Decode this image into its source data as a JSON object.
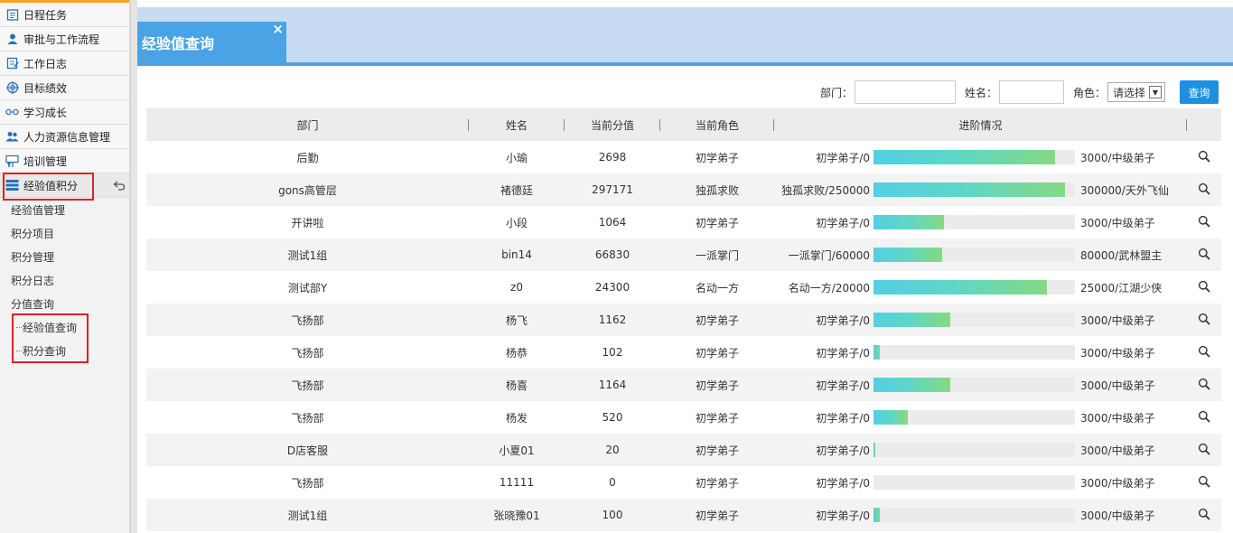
{
  "sidebar": {
    "menu": [
      {
        "label": "日程任务",
        "icon": "calendar-icon"
      },
      {
        "label": "审批与工作流程",
        "icon": "approval-user-icon"
      },
      {
        "label": "工作日志",
        "icon": "worklog-icon"
      },
      {
        "label": "目标绩效",
        "icon": "target-icon"
      },
      {
        "label": "学习成长",
        "icon": "glasses-icon"
      },
      {
        "label": "人力资源信息管理",
        "icon": "people-icon"
      },
      {
        "label": "培训管理",
        "icon": "training-icon"
      },
      {
        "label": "经验值积分",
        "icon": "stack-icon"
      }
    ],
    "sub_items": [
      "经验值管理",
      "积分项目",
      "积分管理",
      "积分日志",
      "分值查询"
    ],
    "sub_sub_items": [
      "经验值查询",
      "积分查询"
    ]
  },
  "tab": {
    "title": "经验值查询",
    "close": "×"
  },
  "search": {
    "dept_label": "部门：",
    "name_label": "姓名：",
    "role_label": "角色：",
    "role_value": "请选择",
    "query_button": "查询"
  },
  "table": {
    "headers": [
      "部门",
      "姓名",
      "当前分值",
      "当前角色",
      "进阶情况"
    ],
    "rows": [
      {
        "dept": "后勤",
        "name": "小瑜",
        "score": "2698",
        "role": "初学弟子",
        "from": "初学弟子/0",
        "to": "3000/中级弟子",
        "progress": 0.9
      },
      {
        "dept": "gons高管层",
        "name": "褚德廷",
        "score": "297171",
        "role": "独孤求败",
        "from": "独孤求败/250000",
        "to": "300000/天外飞仙",
        "progress": 0.95
      },
      {
        "dept": "开讲啦",
        "name": "小段",
        "score": "1064",
        "role": "初学弟子",
        "from": "初学弟子/0",
        "to": "3000/中级弟子",
        "progress": 0.35
      },
      {
        "dept": "测试1组",
        "name": "bin14",
        "score": "66830",
        "role": "一派掌门",
        "from": "一派掌门/60000",
        "to": "80000/武林盟主",
        "progress": 0.34
      },
      {
        "dept": "测试部Y",
        "name": "z0",
        "score": "24300",
        "role": "名动一方",
        "from": "名动一方/20000",
        "to": "25000/江湖少侠",
        "progress": 0.86
      },
      {
        "dept": "飞扬部",
        "name": "杨飞",
        "score": "1162",
        "role": "初学弟子",
        "from": "初学弟子/0",
        "to": "3000/中级弟子",
        "progress": 0.38
      },
      {
        "dept": "飞扬部",
        "name": "杨恭",
        "score": "102",
        "role": "初学弟子",
        "from": "初学弟子/0",
        "to": "3000/中级弟子",
        "progress": 0.03
      },
      {
        "dept": "飞扬部",
        "name": "杨喜",
        "score": "1164",
        "role": "初学弟子",
        "from": "初学弟子/0",
        "to": "3000/中级弟子",
        "progress": 0.38
      },
      {
        "dept": "飞扬部",
        "name": "杨发",
        "score": "520",
        "role": "初学弟子",
        "from": "初学弟子/0",
        "to": "3000/中级弟子",
        "progress": 0.17
      },
      {
        "dept": "D店客服",
        "name": "小夏01",
        "score": "20",
        "role": "初学弟子",
        "from": "初学弟子/0",
        "to": "3000/中级弟子",
        "progress": 0.01
      },
      {
        "dept": "飞扬部",
        "name": "11111",
        "score": "0",
        "role": "初学弟子",
        "from": "初学弟子/0",
        "to": "3000/中级弟子",
        "progress": 0.0
      },
      {
        "dept": "测试1组",
        "name": "张晓豫01",
        "score": "100",
        "role": "初学弟子",
        "from": "初学弟子/0",
        "to": "3000/中级弟子",
        "progress": 0.03
      }
    ]
  },
  "colors": {
    "accent": "#4aa3e4",
    "tabbar": "#c7dcf2",
    "button": "#1e8fe1",
    "highlight": "#e02020"
  }
}
